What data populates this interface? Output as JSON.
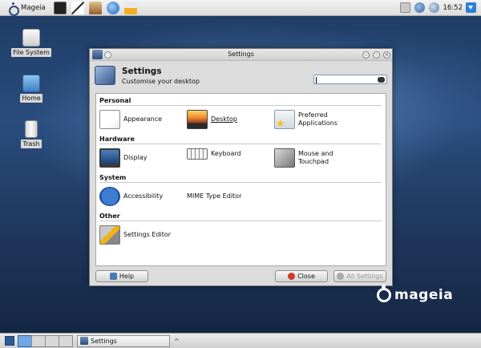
{
  "top_panel": {
    "menu_label": "Mageia",
    "clock": "16:52"
  },
  "desktop": {
    "icons": [
      {
        "label": "File System"
      },
      {
        "label": "Home"
      },
      {
        "label": "Trash"
      }
    ]
  },
  "window": {
    "title": "Settings",
    "header_title": "Settings",
    "header_subtitle": "Customise your desktop",
    "search": {
      "value": "",
      "placeholder": ""
    },
    "categories": {
      "personal": "Personal",
      "hardware": "Hardware",
      "system": "System",
      "other": "Other"
    },
    "items": {
      "appearance": "Appearance",
      "desktop": "Desktop",
      "preferred_line1": "Preferred",
      "preferred_line2": "Applications",
      "display": "Display",
      "keyboard": "Keyboard",
      "mouse_line1": "Mouse and",
      "mouse_line2": "Touchpad",
      "accessibility": "Accessibility",
      "mime": "MIME Type Editor",
      "settings_editor": "Settings Editor"
    },
    "buttons": {
      "help": "Help",
      "close": "Close",
      "all_settings": "All Settings"
    }
  },
  "watermark": "mageia",
  "taskbar": {
    "task_label": "Settings"
  },
  "colors": {
    "desktop_bg": "#1e3559",
    "panel_bg": "#dcdcdc",
    "accent": "#2c5c98"
  },
  "icons": [
    "mageia-menu-icon",
    "terminal-icon",
    "text-editor-icon",
    "paint-icon",
    "web-browser-icon",
    "scanner-icon",
    "network-icon",
    "globe-icon",
    "update-icon",
    "download-icon"
  ]
}
